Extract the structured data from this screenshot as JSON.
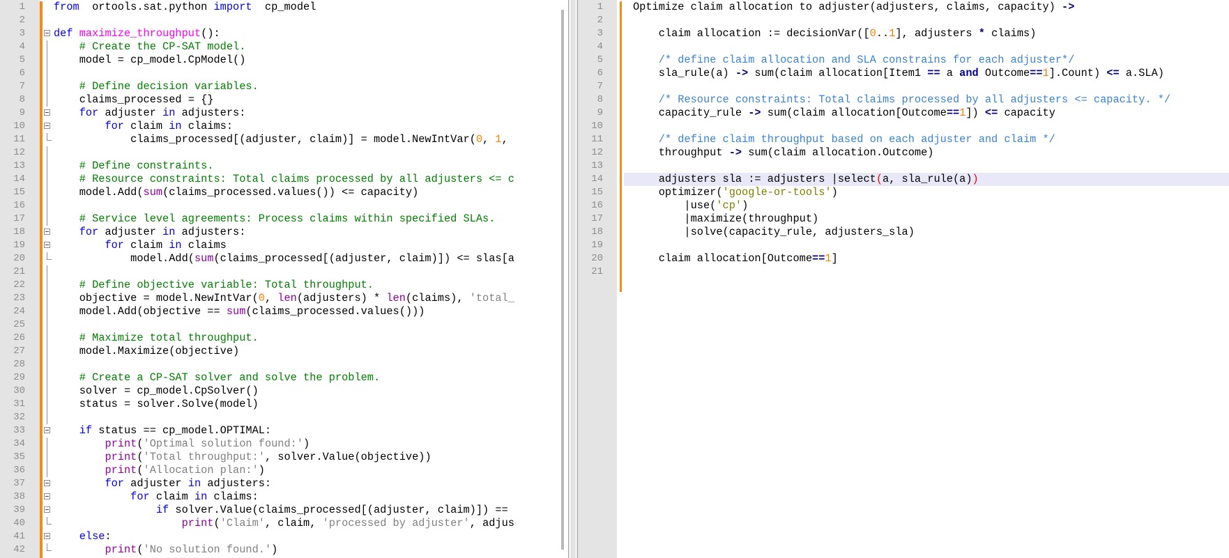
{
  "left_editor": {
    "language": "python",
    "lines": [
      {
        "n": "1",
        "fold": "",
        "indent": 0,
        "tokens": [
          [
            "kw",
            "from"
          ],
          [
            "",
            "  ortools.sat.python "
          ],
          [
            "kw",
            "import"
          ],
          [
            "",
            "  cp_model"
          ]
        ]
      },
      {
        "n": "2",
        "fold": "",
        "indent": 0,
        "tokens": []
      },
      {
        "n": "3",
        "fold": "open",
        "indent": 0,
        "tokens": [
          [
            "kw",
            "def"
          ],
          [
            "",
            " "
          ],
          [
            "fn",
            "maximize_throughput"
          ],
          [
            "",
            "():"
          ]
        ]
      },
      {
        "n": "4",
        "fold": "line",
        "indent": 0,
        "tokens": [
          [
            "",
            "    "
          ],
          [
            "cm",
            "# Create the CP-SAT model."
          ]
        ]
      },
      {
        "n": "5",
        "fold": "line",
        "indent": 0,
        "tokens": [
          [
            "",
            "    model = cp_model.CpModel()"
          ]
        ]
      },
      {
        "n": "6",
        "fold": "line",
        "indent": 0,
        "tokens": []
      },
      {
        "n": "7",
        "fold": "line",
        "indent": 0,
        "tokens": [
          [
            "",
            "    "
          ],
          [
            "cm",
            "# Define decision variables."
          ]
        ]
      },
      {
        "n": "8",
        "fold": "line",
        "indent": 0,
        "tokens": [
          [
            "",
            "    claims_processed = {}"
          ]
        ]
      },
      {
        "n": "9",
        "fold": "open",
        "indent": 0,
        "tokens": [
          [
            "",
            "    "
          ],
          [
            "kw",
            "for"
          ],
          [
            "",
            " adjuster "
          ],
          [
            "kw",
            "in"
          ],
          [
            "",
            " adjusters:"
          ]
        ]
      },
      {
        "n": "10",
        "fold": "open",
        "indent": 0,
        "tokens": [
          [
            "",
            "        "
          ],
          [
            "kw",
            "for"
          ],
          [
            "",
            " claim "
          ],
          [
            "kw",
            "in"
          ],
          [
            "",
            " claims:"
          ]
        ]
      },
      {
        "n": "11",
        "fold": "end",
        "indent": 0,
        "tokens": [
          [
            "",
            "            claims_processed[(adjuster, claim)] = model.NewIntVar("
          ],
          [
            "nm",
            "0"
          ],
          [
            "",
            ", "
          ],
          [
            "nm",
            "1"
          ],
          [
            "",
            ","
          ]
        ]
      },
      {
        "n": "12",
        "fold": "line",
        "indent": 0,
        "tokens": []
      },
      {
        "n": "13",
        "fold": "line",
        "indent": 0,
        "tokens": [
          [
            "",
            "    "
          ],
          [
            "cm",
            "# Define constraints."
          ]
        ]
      },
      {
        "n": "14",
        "fold": "line",
        "indent": 0,
        "tokens": [
          [
            "",
            "    "
          ],
          [
            "cm",
            "# Resource constraints: Total claims processed by all adjusters <= c"
          ]
        ]
      },
      {
        "n": "15",
        "fold": "line",
        "indent": 0,
        "tokens": [
          [
            "",
            "    model.Add("
          ],
          [
            "bi",
            "sum"
          ],
          [
            "",
            "(claims_processed.values()) <= capacity)"
          ]
        ]
      },
      {
        "n": "16",
        "fold": "line",
        "indent": 0,
        "tokens": []
      },
      {
        "n": "17",
        "fold": "line",
        "indent": 0,
        "tokens": [
          [
            "",
            "    "
          ],
          [
            "cm",
            "# Service level agreements: Process claims within specified SLAs."
          ]
        ]
      },
      {
        "n": "18",
        "fold": "open",
        "indent": 0,
        "tokens": [
          [
            "",
            "    "
          ],
          [
            "kw",
            "for"
          ],
          [
            "",
            " adjuster "
          ],
          [
            "kw",
            "in"
          ],
          [
            "",
            " adjusters:"
          ]
        ]
      },
      {
        "n": "19",
        "fold": "open",
        "indent": 0,
        "tokens": [
          [
            "",
            "        "
          ],
          [
            "kw",
            "for"
          ],
          [
            "",
            " claim "
          ],
          [
            "kw",
            "in"
          ],
          [
            "",
            " claims"
          ]
        ]
      },
      {
        "n": "20",
        "fold": "end",
        "indent": 0,
        "tokens": [
          [
            "",
            "            model.Add("
          ],
          [
            "bi",
            "sum"
          ],
          [
            "",
            "(claims_processed[(adjuster, claim)]) <= slas[a"
          ]
        ]
      },
      {
        "n": "21",
        "fold": "line",
        "indent": 0,
        "tokens": []
      },
      {
        "n": "22",
        "fold": "line",
        "indent": 0,
        "tokens": [
          [
            "",
            "    "
          ],
          [
            "cm",
            "# Define objective variable: Total throughput."
          ]
        ]
      },
      {
        "n": "23",
        "fold": "line",
        "indent": 0,
        "tokens": [
          [
            "",
            "    objective = model.NewIntVar("
          ],
          [
            "nm",
            "0"
          ],
          [
            "",
            ", "
          ],
          [
            "bi",
            "len"
          ],
          [
            "",
            "(adjusters) * "
          ],
          [
            "bi",
            "len"
          ],
          [
            "",
            "(claims), "
          ],
          [
            "st",
            "'total_"
          ]
        ]
      },
      {
        "n": "24",
        "fold": "line",
        "indent": 0,
        "tokens": [
          [
            "",
            "    model.Add(objective == "
          ],
          [
            "bi",
            "sum"
          ],
          [
            "",
            "(claims_processed.values()))"
          ]
        ]
      },
      {
        "n": "25",
        "fold": "line",
        "indent": 0,
        "tokens": []
      },
      {
        "n": "26",
        "fold": "line",
        "indent": 0,
        "tokens": [
          [
            "",
            "    "
          ],
          [
            "cm",
            "# Maximize total throughput."
          ]
        ]
      },
      {
        "n": "27",
        "fold": "line",
        "indent": 0,
        "tokens": [
          [
            "",
            "    model.Maximize(objective)"
          ]
        ]
      },
      {
        "n": "28",
        "fold": "line",
        "indent": 0,
        "tokens": []
      },
      {
        "n": "29",
        "fold": "line",
        "indent": 0,
        "tokens": [
          [
            "",
            "    "
          ],
          [
            "cm",
            "# Create a CP-SAT solver and solve the problem."
          ]
        ]
      },
      {
        "n": "30",
        "fold": "line",
        "indent": 0,
        "tokens": [
          [
            "",
            "    solver = cp_model.CpSolver()"
          ]
        ]
      },
      {
        "n": "31",
        "fold": "line",
        "indent": 0,
        "tokens": [
          [
            "",
            "    status = solver.Solve(model)"
          ]
        ]
      },
      {
        "n": "32",
        "fold": "line",
        "indent": 0,
        "tokens": []
      },
      {
        "n": "33",
        "fold": "open",
        "indent": 0,
        "tokens": [
          [
            "",
            "    "
          ],
          [
            "kw",
            "if"
          ],
          [
            "",
            " status == cp_model.OPTIMAL:"
          ]
        ]
      },
      {
        "n": "34",
        "fold": "line",
        "indent": 0,
        "tokens": [
          [
            "",
            "        "
          ],
          [
            "bi",
            "print"
          ],
          [
            "",
            "("
          ],
          [
            "st",
            "'Optimal solution found:'"
          ],
          [
            "",
            ")"
          ]
        ]
      },
      {
        "n": "35",
        "fold": "line",
        "indent": 0,
        "tokens": [
          [
            "",
            "        "
          ],
          [
            "bi",
            "print"
          ],
          [
            "",
            "("
          ],
          [
            "st",
            "'Total throughput:'"
          ],
          [
            "",
            ", solver.Value(objective))"
          ]
        ]
      },
      {
        "n": "36",
        "fold": "line",
        "indent": 0,
        "tokens": [
          [
            "",
            "        "
          ],
          [
            "bi",
            "print"
          ],
          [
            "",
            "("
          ],
          [
            "st",
            "'Allocation plan:'"
          ],
          [
            "",
            ")"
          ]
        ]
      },
      {
        "n": "37",
        "fold": "open",
        "indent": 0,
        "tokens": [
          [
            "",
            "        "
          ],
          [
            "kw",
            "for"
          ],
          [
            "",
            " adjuster "
          ],
          [
            "kw",
            "in"
          ],
          [
            "",
            " adjusters:"
          ]
        ]
      },
      {
        "n": "38",
        "fold": "open",
        "indent": 0,
        "tokens": [
          [
            "",
            "            "
          ],
          [
            "kw",
            "for"
          ],
          [
            "",
            " claim "
          ],
          [
            "kw",
            "in"
          ],
          [
            "",
            " claims:"
          ]
        ]
      },
      {
        "n": "39",
        "fold": "open",
        "indent": 0,
        "tokens": [
          [
            "",
            "                "
          ],
          [
            "kw",
            "if"
          ],
          [
            "",
            " solver.Value(claims_processed[(adjuster, claim)]) =="
          ]
        ]
      },
      {
        "n": "40",
        "fold": "end",
        "indent": 0,
        "tokens": [
          [
            "",
            "                    "
          ],
          [
            "bi",
            "print"
          ],
          [
            "",
            "("
          ],
          [
            "st",
            "'Claim'"
          ],
          [
            "",
            ", claim, "
          ],
          [
            "st",
            "'processed by adjuster'"
          ],
          [
            "",
            ", adjus"
          ]
        ]
      },
      {
        "n": "41",
        "fold": "open",
        "indent": 0,
        "tokens": [
          [
            "",
            "    "
          ],
          [
            "kw",
            "else"
          ],
          [
            "",
            ":"
          ]
        ]
      },
      {
        "n": "42",
        "fold": "end",
        "indent": 0,
        "tokens": [
          [
            "",
            "        "
          ],
          [
            "bi",
            "print"
          ],
          [
            "",
            "("
          ],
          [
            "st",
            "'No solution found.'"
          ],
          [
            "",
            ")"
          ]
        ]
      }
    ]
  },
  "right_editor": {
    "language": "dsl",
    "highlighted_line": "14",
    "lines": [
      {
        "n": "1",
        "tokens": [
          [
            "",
            "Optimize claim allocation to adjuster(adjusters, claims, capacity) "
          ],
          [
            "op",
            "->"
          ]
        ]
      },
      {
        "n": "2",
        "tokens": []
      },
      {
        "n": "3",
        "tokens": [
          [
            "",
            "    claim allocation := decisionVar(["
          ],
          [
            "nm",
            "0"
          ],
          [
            "",
            "."
          ],
          [
            "",
            "."
          ],
          [
            "nm",
            "1"
          ],
          [
            "",
            "], adjusters "
          ],
          [
            "op",
            "*"
          ],
          [
            "",
            " claims)"
          ]
        ]
      },
      {
        "n": "4",
        "tokens": []
      },
      {
        "n": "5",
        "tokens": [
          [
            "",
            "    "
          ],
          [
            "cm2",
            "/* define claim allocation and SLA constrains for each adjuster*/"
          ]
        ]
      },
      {
        "n": "6",
        "tokens": [
          [
            "",
            "    sla_rule(a) "
          ],
          [
            "op",
            "->"
          ],
          [
            "",
            " sum(claim allocation[Item1 "
          ],
          [
            "op",
            "=="
          ],
          [
            "",
            " a "
          ],
          [
            "kw2",
            "and"
          ],
          [
            "",
            " Outcome"
          ],
          [
            "op",
            "=="
          ],
          [
            "nm",
            "1"
          ],
          [
            "",
            "].Count) "
          ],
          [
            "op",
            "<="
          ],
          [
            "",
            " a.SLA)"
          ]
        ]
      },
      {
        "n": "7",
        "tokens": []
      },
      {
        "n": "8",
        "tokens": [
          [
            "",
            "    "
          ],
          [
            "cm2",
            "/* Resource constraints: Total claims processed by all adjusters <= capacity. */"
          ]
        ]
      },
      {
        "n": "9",
        "tokens": [
          [
            "",
            "    capacity_rule "
          ],
          [
            "op",
            "->"
          ],
          [
            "",
            " sum(claim allocation[Outcome"
          ],
          [
            "op",
            "=="
          ],
          [
            "nm",
            "1"
          ],
          [
            "",
            "]) "
          ],
          [
            "op",
            "<="
          ],
          [
            "",
            " capacity"
          ]
        ]
      },
      {
        "n": "10",
        "tokens": []
      },
      {
        "n": "11",
        "tokens": [
          [
            "",
            "    "
          ],
          [
            "cm2",
            "/* define claim throughput based on each adjuster and claim */"
          ]
        ]
      },
      {
        "n": "12",
        "tokens": [
          [
            "",
            "    throughput "
          ],
          [
            "op",
            "->"
          ],
          [
            "",
            " sum(claim allocation.Outcome)"
          ]
        ]
      },
      {
        "n": "13",
        "tokens": []
      },
      {
        "n": "14",
        "tokens": [
          [
            "",
            "    adjusters sla := adjusters |select"
          ],
          [
            "rp",
            "("
          ],
          [
            "",
            "a, sla_rule(a)"
          ],
          [
            "rp",
            ")"
          ]
        ]
      },
      {
        "n": "15",
        "tokens": [
          [
            "",
            "    optimizer("
          ],
          [
            "st2",
            "'google-or-tools'"
          ],
          [
            "",
            ")"
          ]
        ]
      },
      {
        "n": "16",
        "tokens": [
          [
            "",
            "        |use("
          ],
          [
            "st2",
            "'cp'"
          ],
          [
            "",
            ")"
          ]
        ]
      },
      {
        "n": "17",
        "tokens": [
          [
            "",
            "        |maximize(throughput)"
          ]
        ]
      },
      {
        "n": "18",
        "tokens": [
          [
            "",
            "        |solve(capacity_rule, adjusters_sla)"
          ]
        ]
      },
      {
        "n": "19",
        "tokens": []
      },
      {
        "n": "20",
        "tokens": [
          [
            "",
            "    claim allocation[Outcome"
          ],
          [
            "op",
            "=="
          ],
          [
            "nm",
            "1"
          ],
          [
            "",
            "]"
          ]
        ]
      },
      {
        "n": "21",
        "tokens": []
      }
    ]
  }
}
